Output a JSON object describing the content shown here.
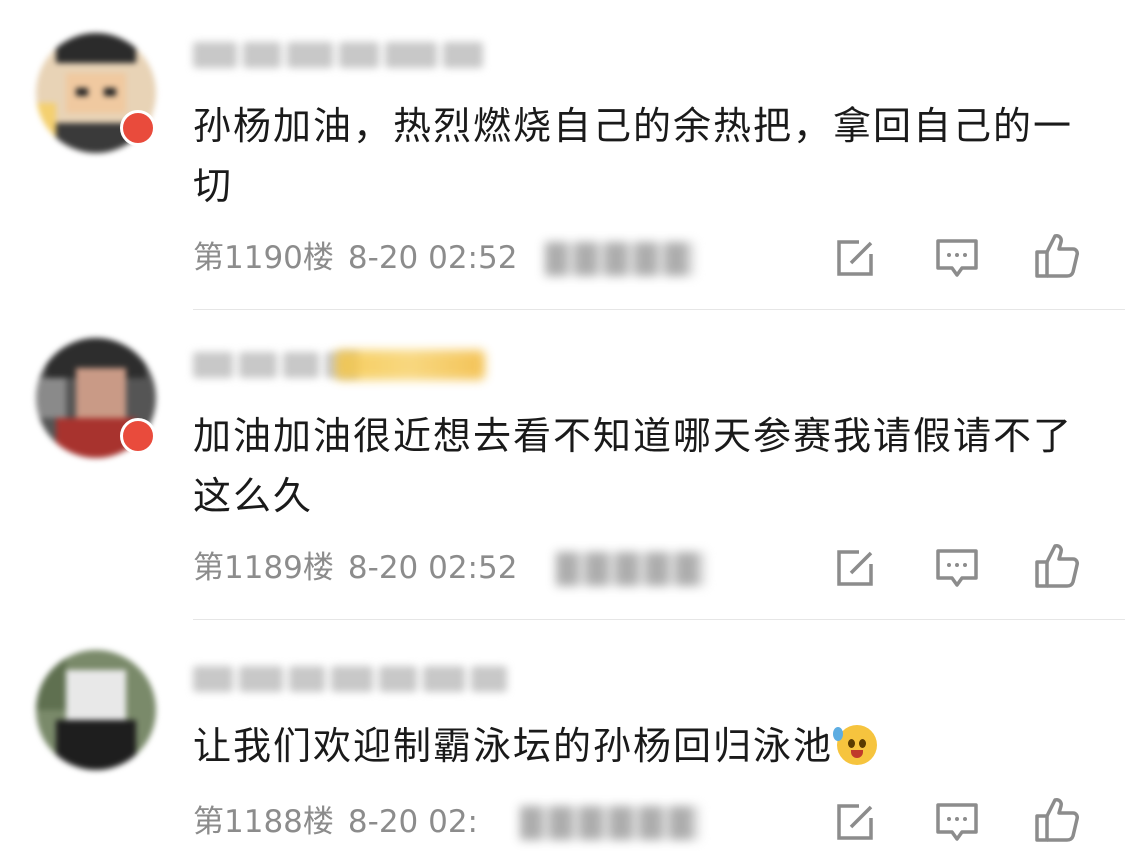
{
  "colors": {
    "text": "#1a1a1a",
    "meta": "#8c8c8c",
    "icon": "#8c8c8c",
    "divider": "#e6e6e6",
    "badge": "#e94b3c",
    "vip": "#f5c542"
  },
  "actions": {
    "edit_icon": "edit-square-icon",
    "reply_icon": "comment-bubble-icon",
    "like_icon": "thumbs-up-icon"
  },
  "comments": [
    {
      "text": "孙杨加油，热烈燃烧自己的余热把，拿回自己的一切",
      "floor": "第1190楼",
      "time": "8-20 02:52"
    },
    {
      "text": "加油加油很近想去看不知道哪天参赛我请假请不了这么久",
      "floor": "第1189楼",
      "time": "8-20 02:52"
    },
    {
      "text": "让我们欢迎制霸泳坛的孙杨回归泳池",
      "emoji": "crying-face-emoji",
      "floor": "第1188楼",
      "time": "8-20 02:"
    }
  ]
}
